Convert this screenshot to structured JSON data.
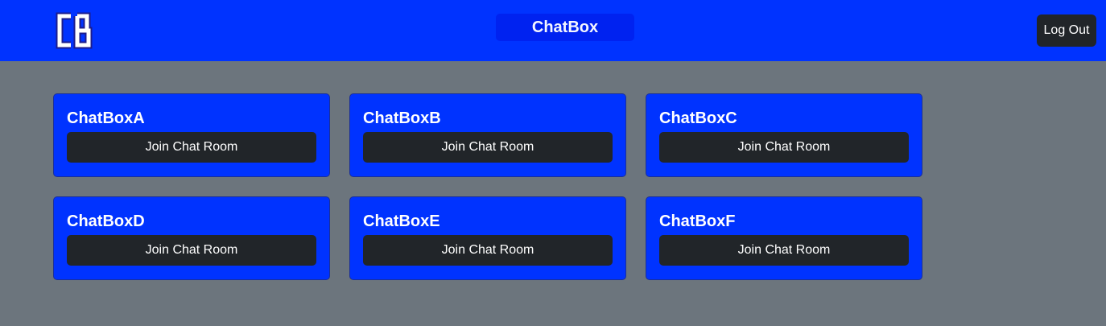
{
  "header": {
    "logo_text": "CB",
    "brand": "ChatBox",
    "logout_label": "Log Out"
  },
  "rooms": [
    {
      "name": "ChatBoxA",
      "button": "Join Chat Room"
    },
    {
      "name": "ChatBoxB",
      "button": "Join Chat Room"
    },
    {
      "name": "ChatBoxC",
      "button": "Join Chat Room"
    },
    {
      "name": "ChatBoxD",
      "button": "Join Chat Room"
    },
    {
      "name": "ChatBoxE",
      "button": "Join Chat Room"
    },
    {
      "name": "ChatBoxF",
      "button": "Join Chat Room"
    }
  ],
  "colors": {
    "navbar": "#0033ff",
    "card": "#0033ff",
    "button": "#212529",
    "page_background": "#6c757d"
  }
}
